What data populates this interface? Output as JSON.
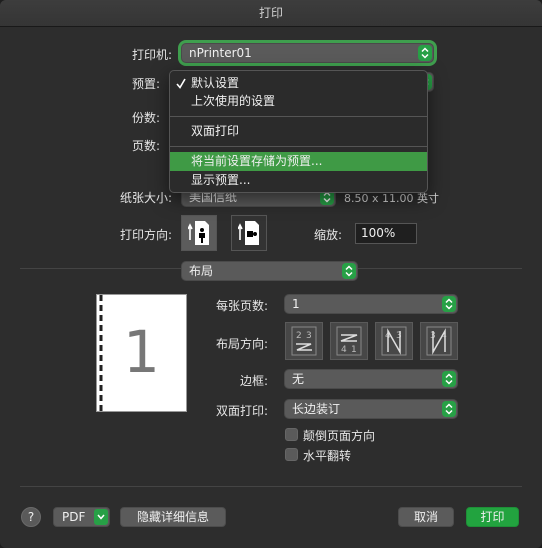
{
  "window": {
    "title": "打印"
  },
  "printer": {
    "label": "打印机:",
    "value": "nPrinter01"
  },
  "presets": {
    "label": "预置:",
    "menu": {
      "items": [
        {
          "label": "默认设置",
          "checked": true
        },
        {
          "label": "上次使用的设置"
        },
        {
          "label": "双面打印"
        },
        {
          "label": "将当前设置存储为预置...",
          "highlighted": true
        },
        {
          "label": "显示预置..."
        }
      ]
    }
  },
  "copies": {
    "label": "份数:"
  },
  "pages": {
    "label": "页数:"
  },
  "paper_size": {
    "label": "纸张大小:",
    "value": "美国信纸",
    "dimensions": "8.50 x 11.00 英寸"
  },
  "orientation": {
    "label": "打印方向:"
  },
  "scale": {
    "label": "缩放:",
    "value": "100%"
  },
  "section": {
    "value": "布局"
  },
  "preview": {
    "page_number": "1"
  },
  "layout": {
    "pages_per_sheet": {
      "label": "每张页数:",
      "value": "1"
    },
    "direction": {
      "label": "布局方向:"
    },
    "border": {
      "label": "边框:",
      "value": "无"
    },
    "duplex": {
      "label": "双面打印:",
      "value": "长边装订"
    },
    "reverse_orientation": {
      "label": "颠倒页面方向"
    },
    "flip_horizontal": {
      "label": "水平翻转"
    }
  },
  "footer": {
    "help": "?",
    "pdf": "PDF",
    "hide_details": "隐藏详细信息",
    "cancel": "取消",
    "print": "打印"
  },
  "colors": {
    "accent": "#27a046",
    "menu_highlight": "#3f9a45",
    "background": "#2d2d2d"
  }
}
